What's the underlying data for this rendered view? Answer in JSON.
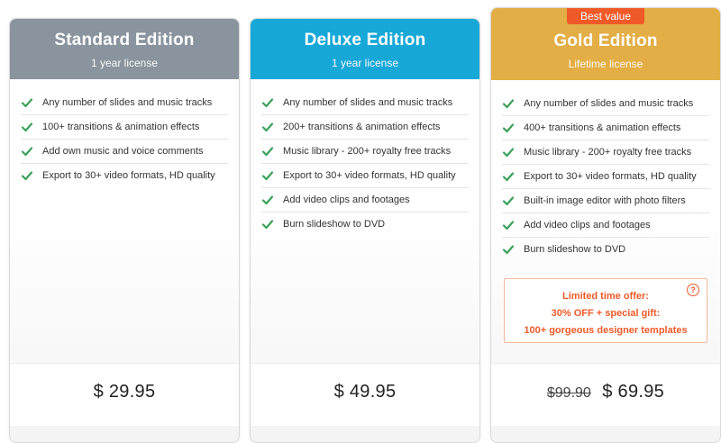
{
  "cards": [
    {
      "title": "Standard Edition",
      "subtitle": "1 year license",
      "header_color": "#8a949e",
      "features": [
        "Any number of slides and music tracks",
        "100+ transitions & animation effects",
        "Add own music and voice comments",
        "Export to 30+ video formats, HD quality"
      ],
      "price": "$ 29.95"
    },
    {
      "title": "Deluxe Edition",
      "subtitle": "1 year license",
      "header_color": "#18a8d8",
      "features": [
        "Any number of slides and music tracks",
        "200+ transitions & animation effects",
        "Music library - 200+ royalty free tracks",
        "Export to 30+ video formats, HD quality",
        "Add video clips and footages",
        "Burn slideshow to DVD"
      ],
      "price": "$ 49.95"
    },
    {
      "title": "Gold Edition",
      "subtitle": "Lifetime license",
      "header_color": "#e2ae45",
      "badge": "Best value",
      "features": [
        "Any number of slides and music tracks",
        "400+ transitions & animation effects",
        "Music library - 200+ royalty free tracks",
        "Export to 30+ video formats, HD quality",
        "Built-in image editor with photo filters",
        "Add video clips and footages",
        "Burn slideshow to DVD"
      ],
      "offer": {
        "line1": "Limited time offer:",
        "line2": "30% OFF + special gift:",
        "line3": "100+ gorgeous designer templates",
        "help_icon": "?"
      },
      "old_price": "$99.90",
      "price": "$ 69.95"
    }
  ],
  "colors": {
    "check": "#3aa15a",
    "offer_accent": "#f05a28"
  },
  "icons": {
    "feature_bullet": "checkmark-icon",
    "offer_help": "help-icon"
  }
}
